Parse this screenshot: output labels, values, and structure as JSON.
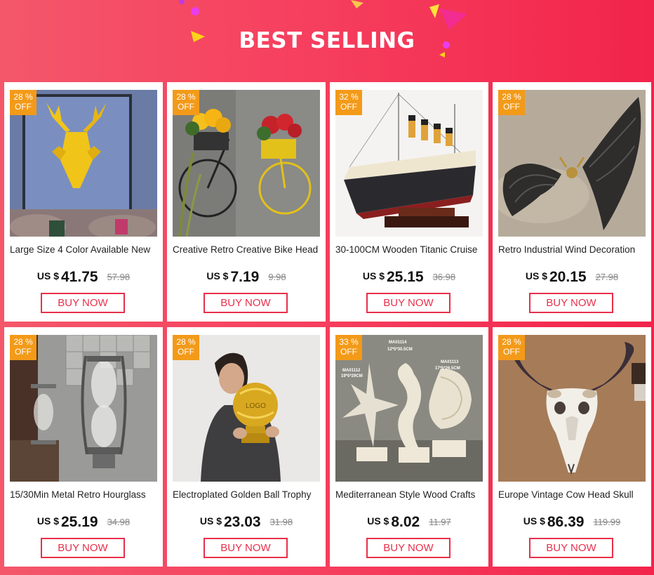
{
  "header": {
    "title": "BEST SELLING"
  },
  "buy_label": "BUY NOW",
  "currency": "US $",
  "products": [
    {
      "name": "Large Size 4 Color Available New",
      "discount": "28 %",
      "off": "OFF",
      "price": "41.75",
      "old_price": "57.98"
    },
    {
      "name": "Creative Retro Creative Bike Head",
      "discount": "28 %",
      "off": "OFF",
      "price": "7.19",
      "old_price": "9.98"
    },
    {
      "name": "30-100CM Wooden Titanic Cruise",
      "discount": "32 %",
      "off": "OFF",
      "price": "25.15",
      "old_price": "36.98"
    },
    {
      "name": "Retro Industrial Wind Decoration",
      "discount": "28 %",
      "off": "OFF",
      "price": "20.15",
      "old_price": "27.98"
    },
    {
      "name": "15/30Min Metal Retro Hourglass",
      "discount": "28 %",
      "off": "OFF",
      "price": "25.19",
      "old_price": "34.98"
    },
    {
      "name": "Electroplated Golden Ball Trophy",
      "discount": "28 %",
      "off": "OFF",
      "price": "23.03",
      "old_price": "31.98"
    },
    {
      "name": "Mediterranean Style Wood Crafts",
      "discount": "33 %",
      "off": "OFF",
      "price": "8.02",
      "old_price": "11.97"
    },
    {
      "name": "Europe Vintage Cow Head Skull",
      "discount": "28 %",
      "off": "OFF",
      "price": "86.39",
      "old_price": "119.99"
    }
  ],
  "image_labels": {
    "trophy_logo": "LOGO",
    "crafts_1": "MA01112",
    "crafts_1_size": "19*5*29CM",
    "crafts_2": "MA01114",
    "crafts_2_size": "12*5*30.5CM",
    "crafts_3": "MA01113",
    "crafts_3_size": "17*5*26.5CM"
  },
  "colors": {
    "accent": "#e8304b",
    "badge": "#f39a19",
    "background": "#f6405f"
  }
}
